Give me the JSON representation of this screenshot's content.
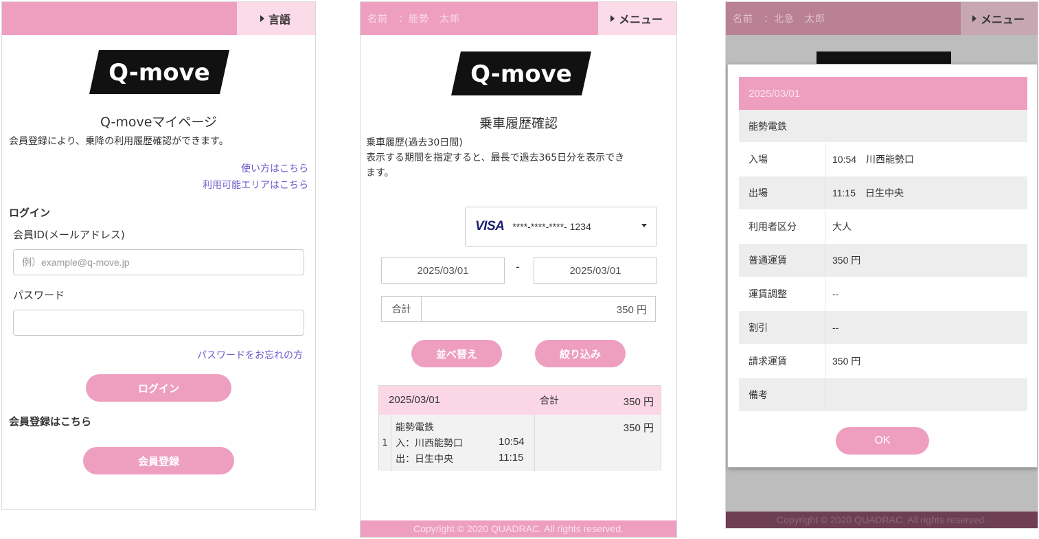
{
  "screen1": {
    "menu_label": "言語",
    "logo_text": "Q-move",
    "page_title": "Q-moveマイページ",
    "intro": "会員登録により、乗降の利用履歴確認ができます。",
    "link_howto": "使い方はこちら",
    "link_area": "利用可能エリアはこちら",
    "login_heading": "ログイン",
    "member_id_label": "会員ID(メールアドレス)",
    "member_id_placeholder": "例）example@q-move.jp",
    "password_label": "パスワード",
    "password_value": "",
    "forgot_link": "パスワードをお忘れの方",
    "login_button": "ログイン",
    "register_heading": "会員登録はこちら",
    "register_button": "会員登録"
  },
  "screen2": {
    "user_name": "名前　：能勢　太郎",
    "menu_label": "メニュー",
    "logo_text": "Q-move",
    "page_title": "乗車履歴確認",
    "desc_line1": "乗車履歴(過去30日間)",
    "desc_line2": "表示する期間を指定すると、最長で過去365日分を表示でき",
    "desc_line3": "ます。",
    "card_brand": "VISA",
    "card_number": "****-****-****- 1234",
    "date_from": "2025/03/01",
    "date_sep": "-",
    "date_to": "2025/03/01",
    "total_label": "合計",
    "total_value": "350 円",
    "sort_button": "並べ替え",
    "filter_button": "絞り込み",
    "history": {
      "date": "2025/03/01",
      "sum_label": "合計",
      "sum_value": "350 円",
      "index": "1",
      "operator": "能勢電鉄",
      "entry": "入：川西能勢口",
      "entry_time": "10:54",
      "exit": "出：日生中央",
      "exit_time": "11:15",
      "fare": "350 円"
    },
    "footer": "Copyright © 2020 QUADRAC. All rights reserved."
  },
  "screen3": {
    "user_name": "名前　：北急　太郎",
    "menu_label": "メニュー",
    "modal": {
      "date": "2025/03/01",
      "operator": "能勢電鉄",
      "rows": [
        {
          "key": "入場",
          "value": "10:54　川西能勢口"
        },
        {
          "key": "出場",
          "value": "11:15　日生中央"
        },
        {
          "key": "利用者区分",
          "value": "大人"
        },
        {
          "key": "普通運賃",
          "value": "350 円"
        },
        {
          "key": "運賃調整",
          "value": "--"
        },
        {
          "key": "割引",
          "value": "--"
        },
        {
          "key": "請求運賃",
          "value": "350 円"
        },
        {
          "key": "備考",
          "value": ""
        }
      ],
      "ok_button": "OK"
    },
    "footer": "Copyright © 2020 QUADRAC. All rights reserved."
  }
}
